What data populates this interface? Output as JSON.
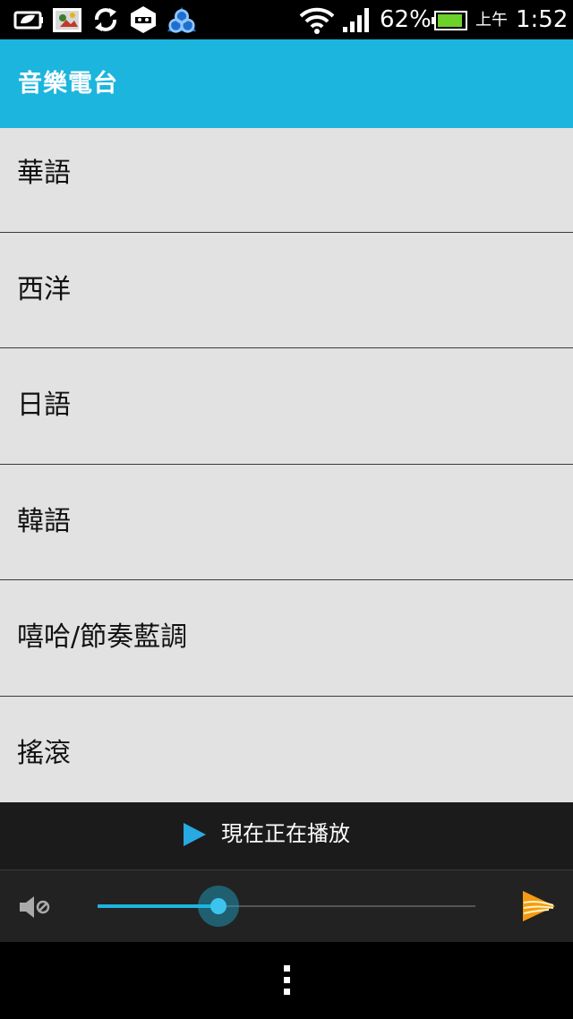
{
  "status_bar": {
    "battery_percent": "62%",
    "am_pm": "上午",
    "time": "1:52",
    "battery_level": 0.62,
    "icons": [
      "battery-saver-icon",
      "photo-app-icon",
      "sync-icon",
      "shield-app-icon",
      "triangle-app-icon",
      "wifi-icon",
      "signal-icon",
      "battery-icon"
    ]
  },
  "app_bar": {
    "title": "音樂電台"
  },
  "genres": [
    {
      "label": "華語"
    },
    {
      "label": "西洋"
    },
    {
      "label": "日語"
    },
    {
      "label": "韓語"
    },
    {
      "label": "嘻哈/節奏藍調"
    },
    {
      "label": "搖滾"
    }
  ],
  "now_playing": {
    "label": "現在正在播放",
    "icon": "play-icon"
  },
  "controls": {
    "mute_icon": "volume-mute-icon",
    "volume": 0.32,
    "logo_icon": "app-logo-icon"
  },
  "nav_bar": {
    "menu_icon": "overflow-menu-icon"
  },
  "colors": {
    "accent": "#1cb5de",
    "list_bg": "#e2e2e2",
    "divider": "#3a3a3a",
    "player_bg": "#1b1b1b",
    "controls_bg": "#222222"
  }
}
